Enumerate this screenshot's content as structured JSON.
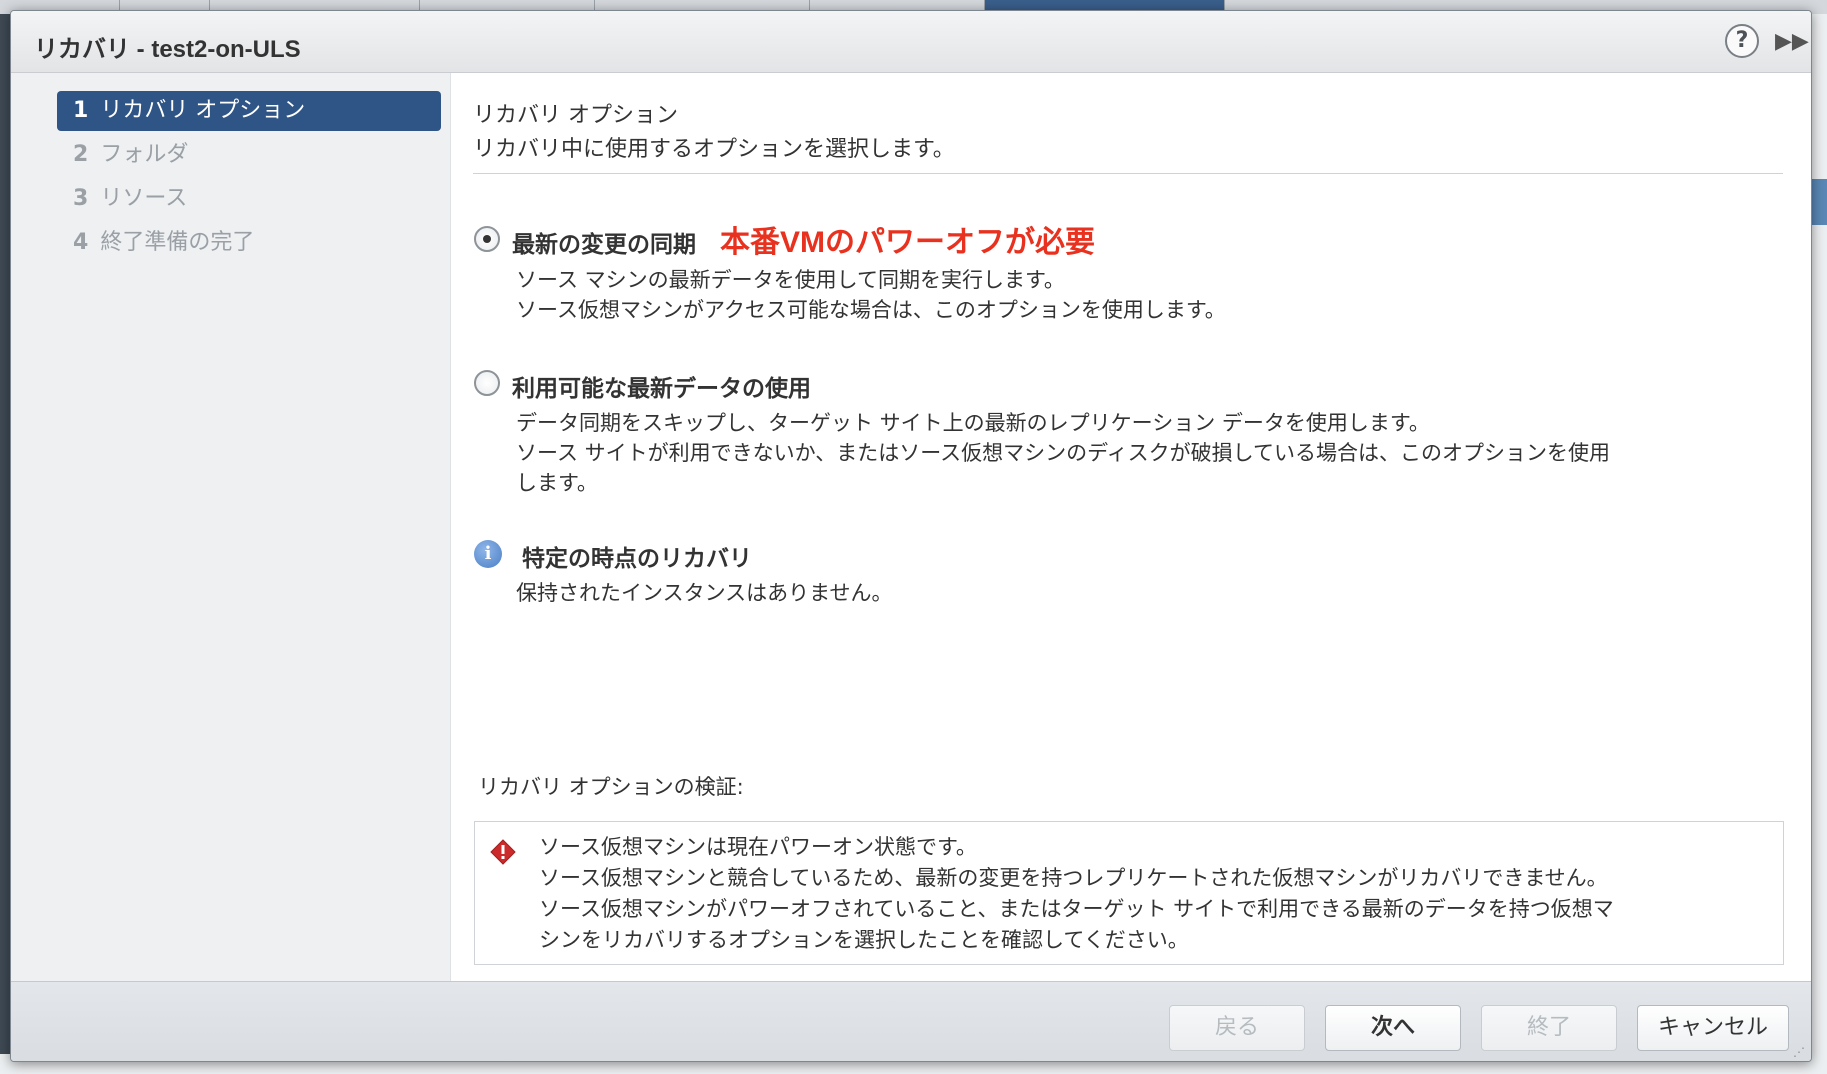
{
  "dialog": {
    "title": "リカバリ - test2-on-ULS",
    "help_label": "?",
    "expand_glyph": "▶▶"
  },
  "nav": {
    "items": [
      {
        "num": "1",
        "label": "リカバリ オプション",
        "active": true
      },
      {
        "num": "2",
        "label": "フォルダ",
        "active": false
      },
      {
        "num": "3",
        "label": "リソース",
        "active": false
      },
      {
        "num": "4",
        "label": "終了準備の完了",
        "active": false
      }
    ]
  },
  "content": {
    "page_title": "リカバリ オプション",
    "page_desc": "リカバリ中に使用するオプションを選択します。",
    "annotation": "本番VMのパワーオフが必要",
    "options": [
      {
        "label": "最新の変更の同期",
        "checked": true,
        "desc": [
          "ソース マシンの最新データを使用して同期を実行します。",
          "ソース仮想マシンがアクセス可能な場合は、このオプションを使用します。"
        ]
      },
      {
        "label": "利用可能な最新データの使用",
        "checked": false,
        "desc": [
          "データ同期をスキップし、ターゲット サイト上の最新のレプリケーション データを使用します。",
          "ソース サイトが利用できないか、またはソース仮想マシンのディスクが破損している場合は、このオプションを使用",
          "します。"
        ]
      }
    ],
    "point_in_time": {
      "icon": "info-icon",
      "label": "特定の時点のリカバリ",
      "desc": "保持されたインスタンスはありません。"
    },
    "verify": {
      "label": "リカバリ オプションの検証:",
      "icon": "error-icon",
      "lines": [
        "ソース仮想マシンは現在パワーオン状態です。",
        "ソース仮想マシンと競合しているため、最新の変更を持つレプリケートされた仮想マシンがリカバリできません。",
        "ソース仮想マシンがパワーオフされていること、またはターゲット サイトで利用できる最新のデータを持つ仮想マ",
        "シンをリカバリするオプションを選択したことを確認してください。"
      ]
    }
  },
  "footer": {
    "back": "戻る",
    "next": "次へ",
    "finish": "終了",
    "cancel": "キャンセル"
  },
  "colors": {
    "nav_active": "#2f5586",
    "annotation": "#e8321f",
    "error": "#cc2b2b",
    "info": "#4b7fc6"
  }
}
